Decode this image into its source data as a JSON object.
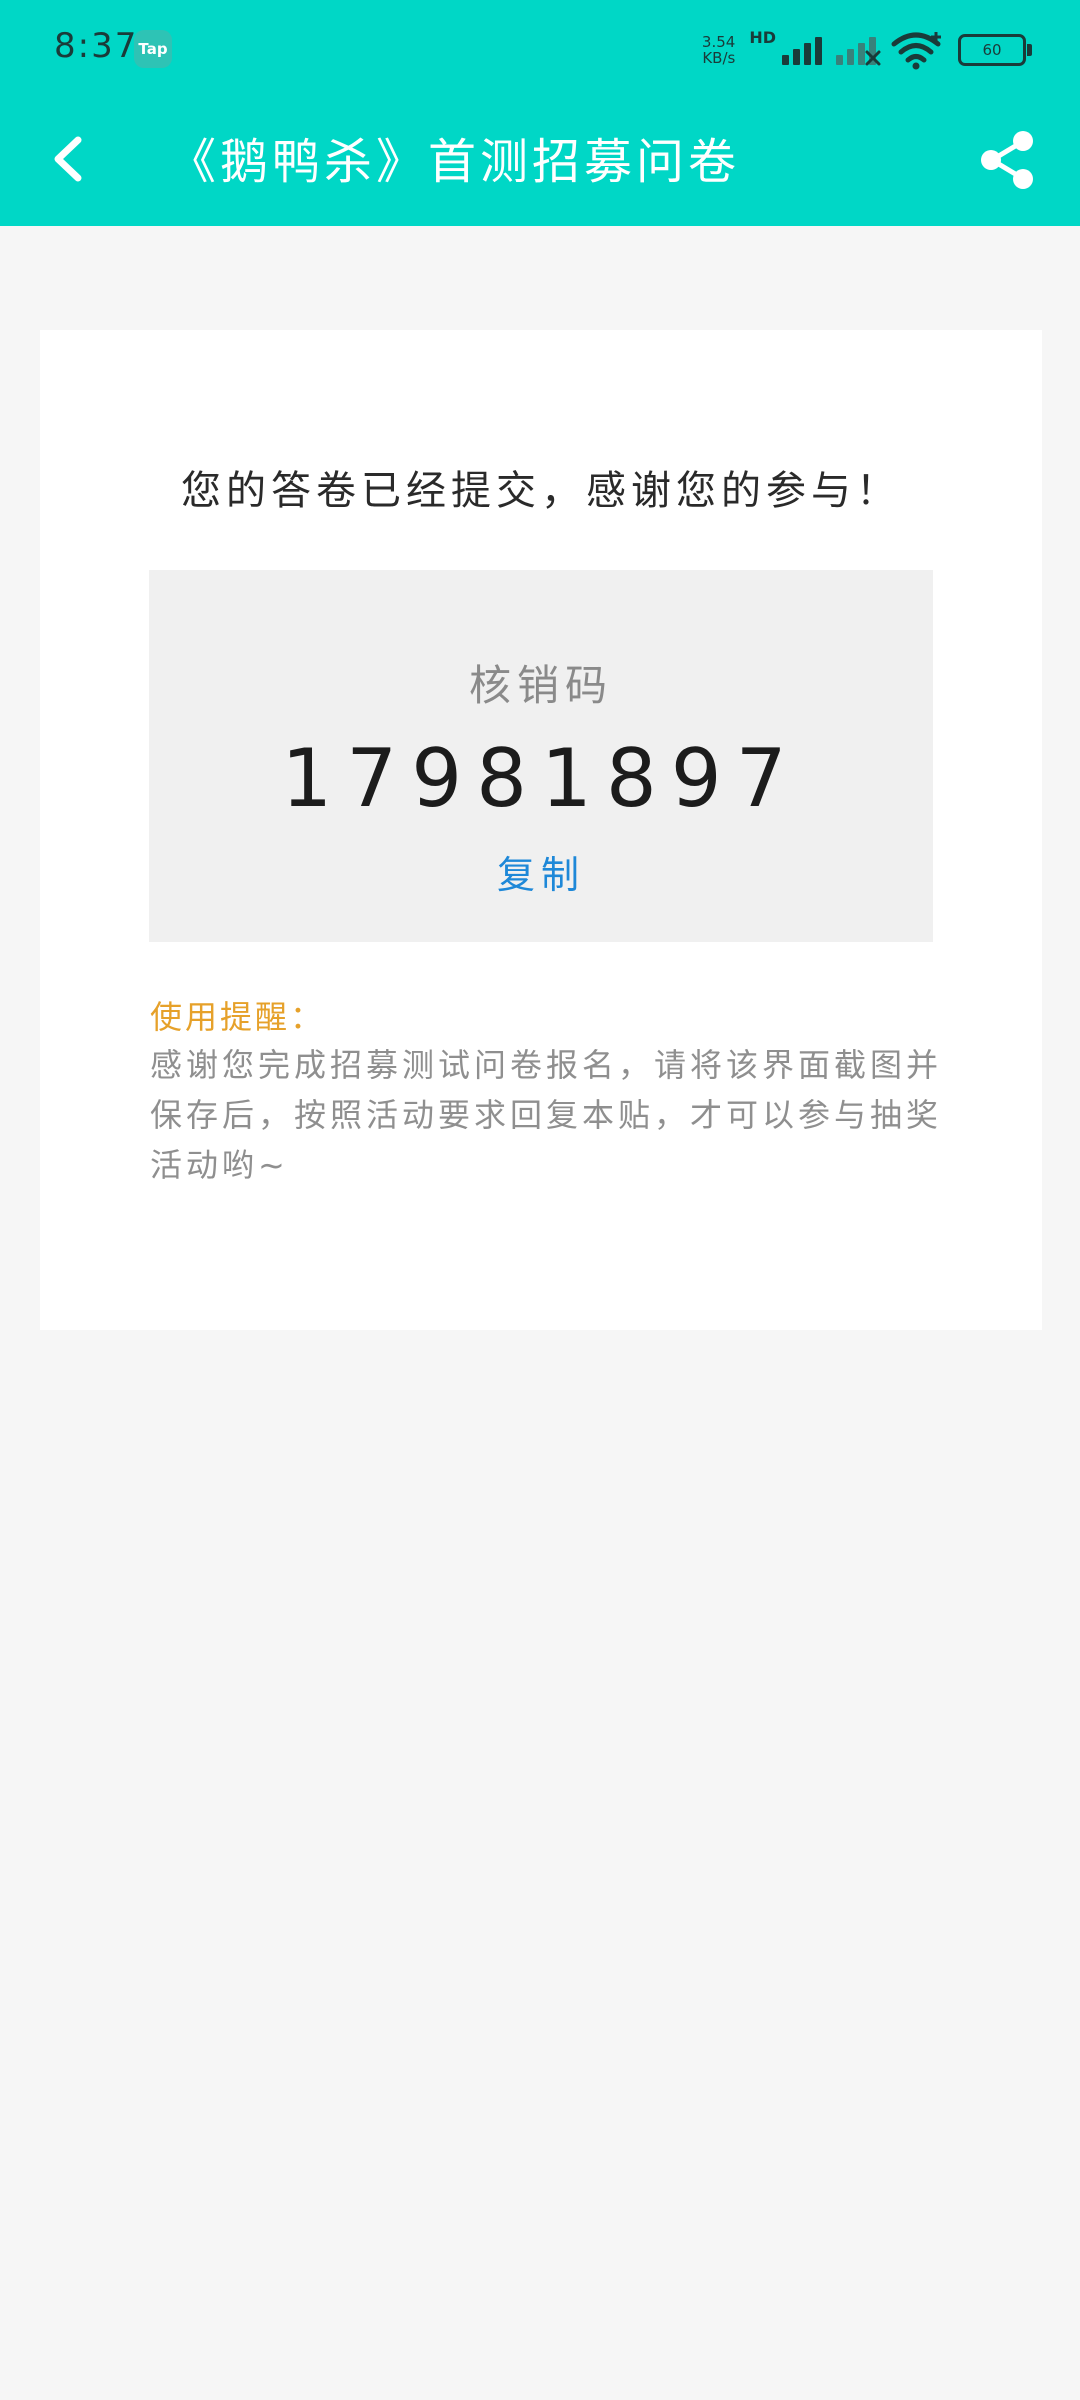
{
  "status_bar": {
    "time": "8:37",
    "app_badge": "Tap",
    "net_speed_value": "3.54",
    "net_speed_unit": "KB/s",
    "hd_label": "HD",
    "battery_level": "60"
  },
  "app_bar": {
    "title": "《鹅鸭杀》首测招募问卷"
  },
  "card": {
    "success_message": "您的答卷已经提交，感谢您的参与！",
    "code_label": "核销码",
    "code_value": "17981897",
    "copy_label": "复制",
    "reminder_title": "使用提醒：",
    "reminder_text": "感谢您完成招募测试问卷报名，请将该界面截图并保存后，按照活动要求回复本贴，才可以参与抽奖活动哟~"
  },
  "colors": {
    "header_bg": "#00d7c6",
    "page_bg": "#f6f6f6",
    "copy_link": "#1e88d8",
    "reminder_title": "#e6a12a"
  }
}
